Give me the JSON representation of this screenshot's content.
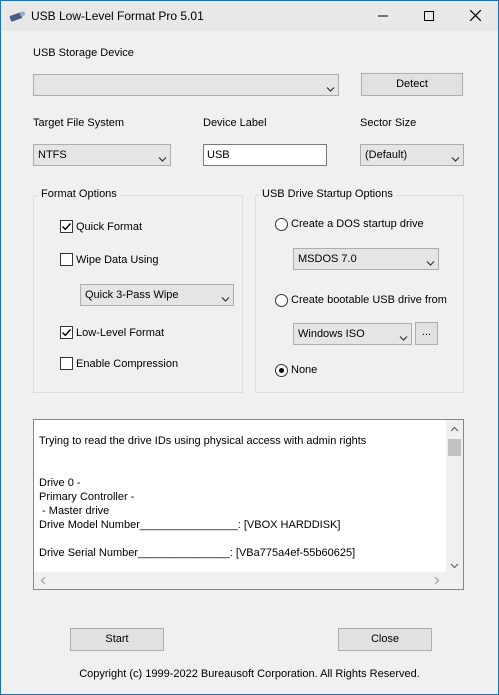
{
  "window": {
    "title": "USB Low-Level Format Pro 5.01",
    "controls": {
      "minimize": "—",
      "maximize": "☐",
      "close": "✕"
    }
  },
  "device": {
    "label": "USB Storage Device",
    "selected": "",
    "detect_button": "Detect"
  },
  "target_fs": {
    "label": "Target File System",
    "selected": "NTFS"
  },
  "device_label": {
    "label": "Device Label",
    "value": "USB"
  },
  "sector_size": {
    "label": "Sector Size",
    "selected": "(Default)"
  },
  "format_options": {
    "title": "Format Options",
    "quick_format": {
      "label": "Quick Format",
      "checked": true
    },
    "wipe_data": {
      "label": "Wipe Data Using",
      "checked": false
    },
    "wipe_method": "Quick 3-Pass Wipe",
    "low_level": {
      "label": "Low-Level Format",
      "checked": true
    },
    "compression": {
      "label": "Enable Compression",
      "checked": false
    }
  },
  "startup_options": {
    "title": "USB Drive Startup Options",
    "dos": {
      "label": "Create a DOS startup drive",
      "selected": false
    },
    "dos_version": "MSDOS 7.0",
    "bootable": {
      "label": "Create bootable USB drive from",
      "selected": false
    },
    "source": "Windows ISO",
    "browse_button": "...",
    "none": {
      "label": "None",
      "selected": true
    }
  },
  "log": {
    "lines": [
      "",
      "Trying to read the drive IDs using physical access with admin rights",
      "",
      "",
      "Drive 0 -",
      "Primary Controller -",
      " - Master drive",
      "Drive Model Number________________: [VBOX HARDDISK]",
      "",
      "Drive Serial Number_______________: [VBa775a4ef-55b60625]"
    ]
  },
  "actions": {
    "start": "Start",
    "close": "Close"
  },
  "footer": "Copyright (c) 1999-2022 Bureausoft Corporation. All Rights Reserved.",
  "colors": {
    "window_bg": "#f0f0f0",
    "title_bg": "#e8e8e8",
    "border_accent": "#1a6fb5"
  }
}
